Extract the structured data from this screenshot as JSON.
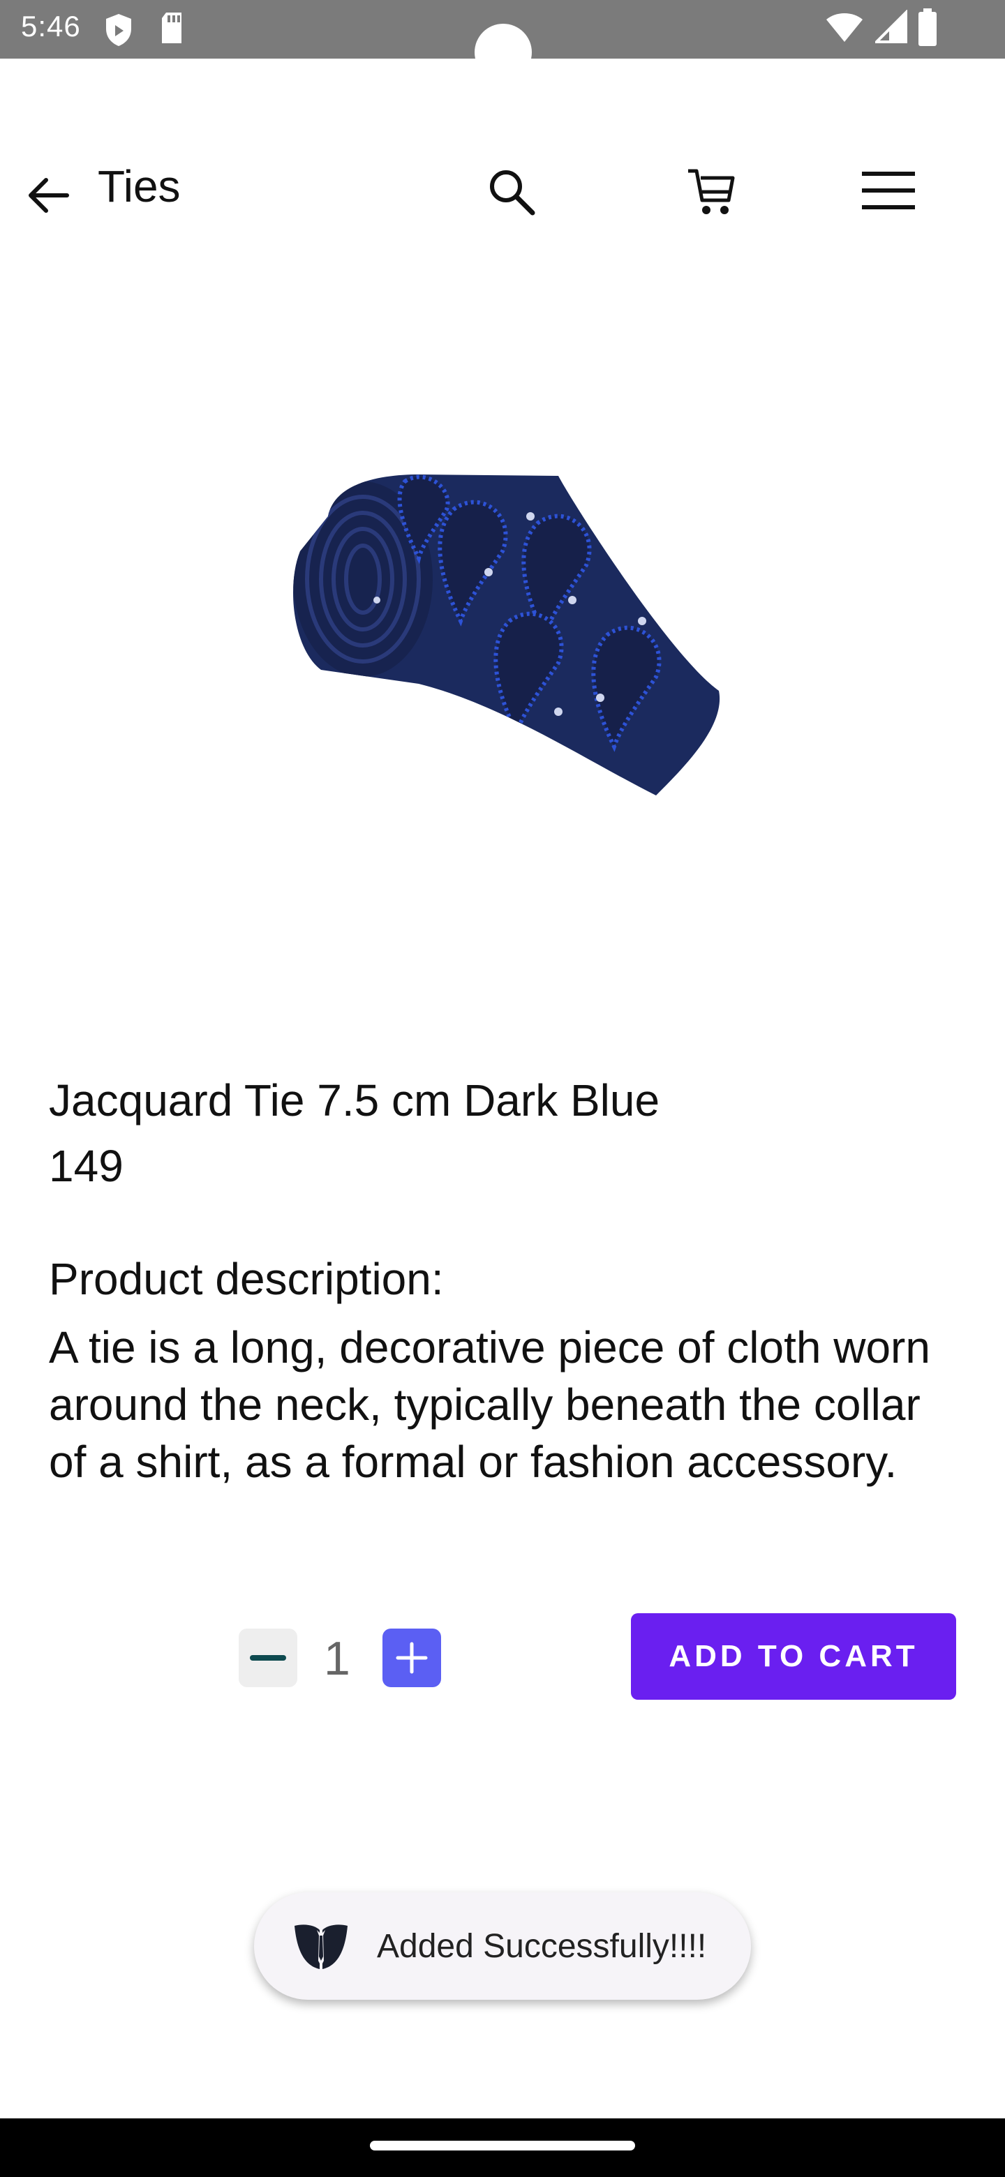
{
  "status_bar": {
    "time": "5:46",
    "left_icons": [
      "shield-icon",
      "sd-card-icon"
    ],
    "right_icons": [
      "wifi-icon",
      "signal-icon",
      "battery-icon"
    ],
    "background": "#7b7b7b"
  },
  "app_bar": {
    "title": "Ties",
    "actions": [
      "search-icon",
      "cart-icon",
      "menu-icon"
    ]
  },
  "product": {
    "image_icon": "tie-image",
    "name": "Jacquard Tie 7.5 cm Dark Blue",
    "price": "149",
    "description_heading": "Product description:",
    "description": "A tie is a long, decorative piece of cloth worn around the neck, typically beneath the collar of a shirt, as a formal or fashion accessory."
  },
  "quantity": {
    "value": "1",
    "minus_icon": "minus-icon",
    "plus_icon": "plus-icon"
  },
  "add_to_cart_label": "ADD TO CART",
  "toast": {
    "message": "Added Successfully!!!!",
    "icon": "suit-logo-icon"
  },
  "colors": {
    "accent": "#6a1ff0",
    "plus_button": "#5b5ff3",
    "tie_navy": "#1b2a5e",
    "tie_pattern": "#2d52d6"
  }
}
